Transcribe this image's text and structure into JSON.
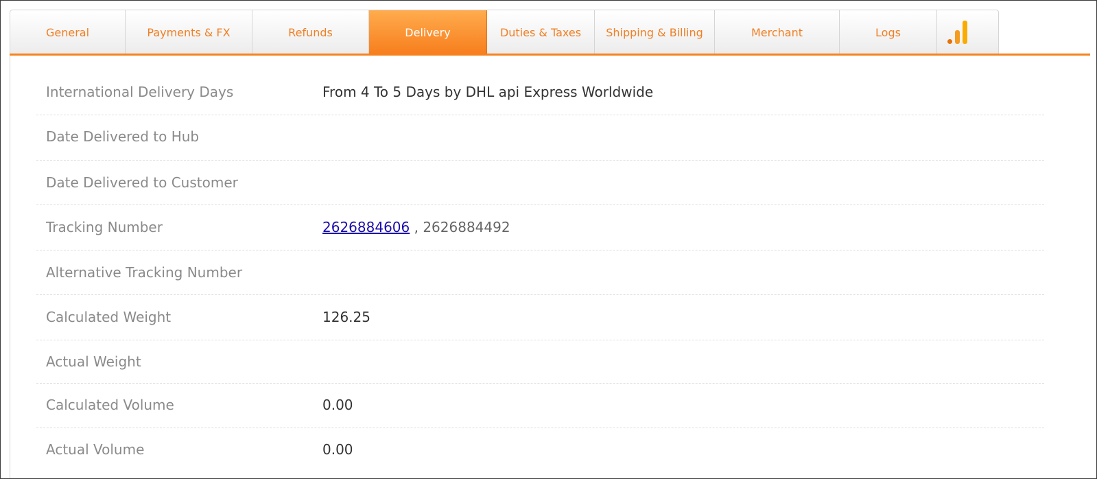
{
  "tabs": [
    {
      "label": "General"
    },
    {
      "label": "Payments & FX"
    },
    {
      "label": "Refunds"
    },
    {
      "label": "Delivery",
      "active": true
    },
    {
      "label": "Duties & Taxes"
    },
    {
      "label": "Shipping & Billing"
    },
    {
      "label": "Merchant"
    },
    {
      "label": "Logs"
    },
    {
      "icon": "analytics-bars-icon"
    }
  ],
  "colors": {
    "accent": "#f7821d",
    "tab_text": "#f07f24",
    "label_text": "#8a8a8a",
    "link": "#1a0dab"
  },
  "delivery": {
    "international_delivery_days": {
      "label": "International Delivery Days",
      "value": "From 4 To 5 Days by DHL api Express Worldwide"
    },
    "date_delivered_to_hub": {
      "label": "Date Delivered to Hub",
      "value": ""
    },
    "date_delivered_to_customer": {
      "label": "Date Delivered to Customer",
      "value": ""
    },
    "tracking_number": {
      "label": "Tracking Number",
      "link": "2626884606",
      "separator": ",",
      "other": "2626884492"
    },
    "alternative_tracking_number": {
      "label": "Alternative Tracking Number",
      "value": ""
    },
    "calculated_weight": {
      "label": "Calculated Weight",
      "value": "126.25"
    },
    "actual_weight": {
      "label": "Actual Weight",
      "value": ""
    },
    "calculated_volume": {
      "label": "Calculated Volume",
      "value": "0.00"
    },
    "actual_volume": {
      "label": "Actual Volume",
      "value": "0.00"
    }
  }
}
